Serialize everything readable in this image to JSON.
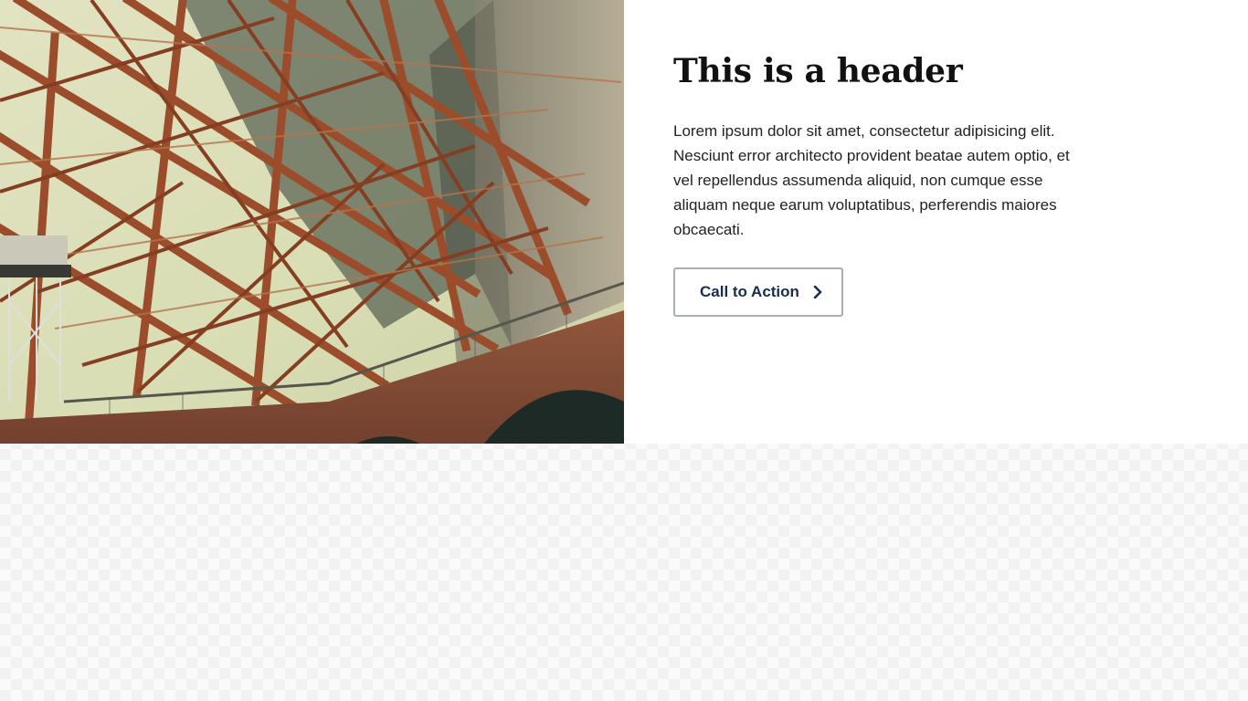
{
  "hero": {
    "image_alt": "Steel arches of a bridge over a brick fort",
    "title": "This is a header",
    "body": "Lorem ipsum dolor sit amet, consectetur adipisicing elit. Nesciunt error architecto provident beatae autem optio, et vel repellendus assumenda aliquid, non cumque esse aliquam neque earum voluptatibus, perferendis maiores obcaecati.",
    "cta_label": "Call to Action",
    "cta_icon": "chevron-right-icon"
  },
  "colors": {
    "cta_text": "#162e51",
    "cta_border": "#a9aeb1",
    "steel": "#a5502c",
    "sky": "#e9edbf"
  }
}
